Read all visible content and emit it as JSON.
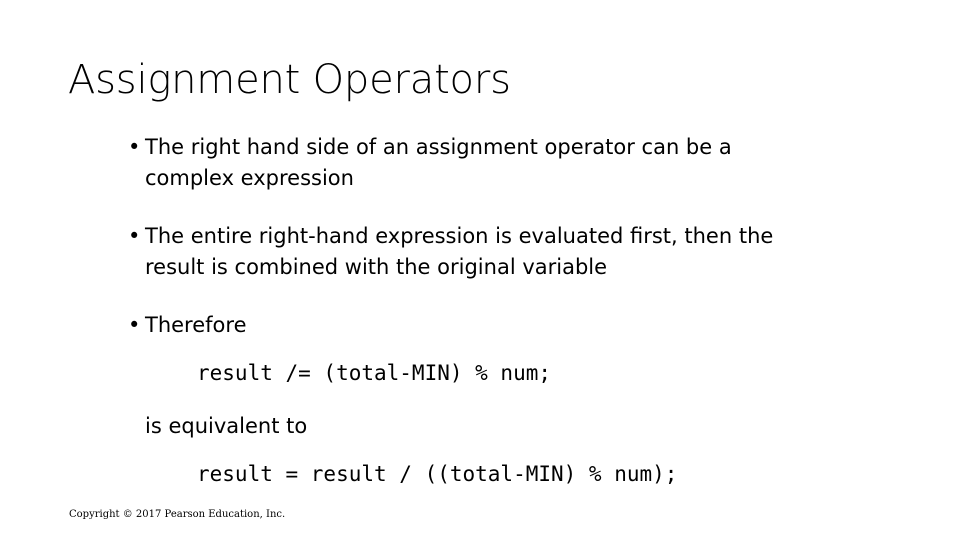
{
  "slide": {
    "title": "Assignment Operators",
    "background_color": "#ffffff",
    "text_color": "#000000",
    "bullet_glyph": "•",
    "bullets": [
      {
        "text": "The right hand side of an assignment operator can be a complex expression"
      },
      {
        "text": "The entire right-hand expression is evaluated first, then the result is combined with the original variable"
      },
      {
        "text": "Therefore"
      }
    ],
    "code_lines": [
      {
        "text": "result /= (total-MIN) % num;"
      },
      {
        "text": "result = result / ((total-MIN) % num);"
      }
    ],
    "equivalence_label": "is equivalent to",
    "footer": "Copyright © 2017 Pearson Education, Inc."
  }
}
